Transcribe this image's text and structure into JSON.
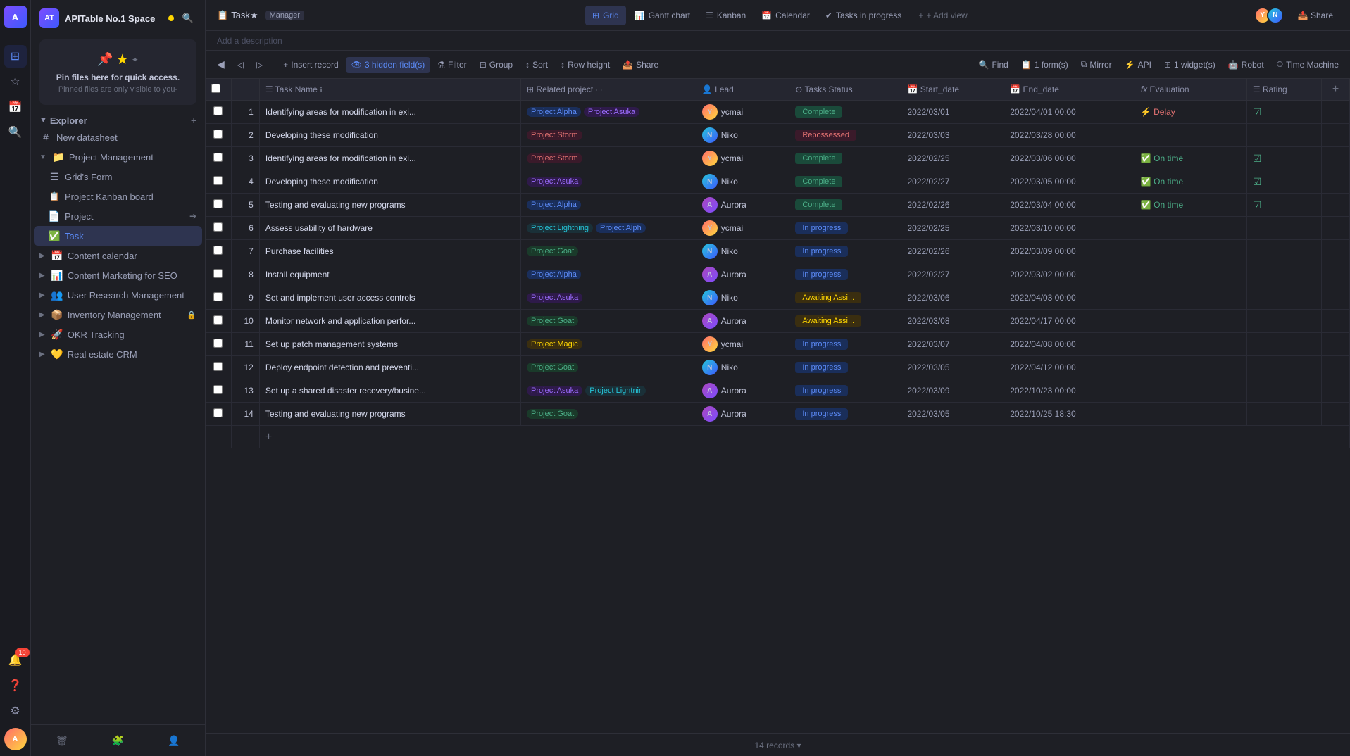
{
  "app": {
    "workspace": "APITable No.1 Space",
    "workspace_status": "online",
    "breadcrumb_task": "Task★",
    "manager_tag": "Manager",
    "add_description": "Add a description"
  },
  "left_icons": [
    "🏠",
    "★",
    "📅",
    "🔔",
    "❓",
    "⚙"
  ],
  "sidebar": {
    "pin_title": "Pin files here for quick access.",
    "pin_sub": "Pinned files are only visible to you-",
    "explorer_label": "Explorer",
    "items": [
      {
        "id": "new-datasheet",
        "label": "New datasheet",
        "icon": "#",
        "indent": 0
      },
      {
        "id": "project-management",
        "label": "Project Management",
        "icon": "📁",
        "indent": 0,
        "expanded": true
      },
      {
        "id": "grids-form",
        "label": "Grid's Form",
        "icon": "☰",
        "indent": 1
      },
      {
        "id": "project-kanban",
        "label": "Project Kanban board",
        "icon": "📋",
        "indent": 1
      },
      {
        "id": "project",
        "label": "Project",
        "icon": "📄",
        "indent": 1
      },
      {
        "id": "task",
        "label": "Task",
        "icon": "✅",
        "indent": 1,
        "active": true
      },
      {
        "id": "content-calendar",
        "label": "Content calendar",
        "icon": "📅",
        "indent": 0
      },
      {
        "id": "content-marketing",
        "label": "Content Marketing for SEO",
        "icon": "📊",
        "indent": 0
      },
      {
        "id": "user-research",
        "label": "User Research Management",
        "icon": "👥",
        "indent": 0
      },
      {
        "id": "inventory",
        "label": "Inventory Management",
        "icon": "📦",
        "indent": 0,
        "locked": true
      },
      {
        "id": "okr-tracking",
        "label": "OKR Tracking",
        "icon": "🚀",
        "indent": 0
      },
      {
        "id": "real-estate",
        "label": "Real estate CRM",
        "icon": "💛",
        "indent": 0
      }
    ]
  },
  "view_tabs": [
    {
      "id": "grid",
      "label": "Grid",
      "icon": "⊞",
      "active": true
    },
    {
      "id": "gantt",
      "label": "Gantt chart",
      "icon": "📊"
    },
    {
      "id": "kanban",
      "label": "Kanban",
      "icon": "☰"
    },
    {
      "id": "calendar",
      "label": "Calendar",
      "icon": "📅"
    },
    {
      "id": "tasks-progress",
      "label": "Tasks in progress",
      "icon": "✔"
    },
    {
      "id": "add-view",
      "label": "+ Add view",
      "icon": ""
    }
  ],
  "toolbar": {
    "insert_record": "Insert record",
    "hidden_fields": "3 hidden field(s)",
    "filter": "Filter",
    "group": "Group",
    "sort": "Sort",
    "row_height": "Row height",
    "share": "Share",
    "find": "Find",
    "forms": "1 form(s)",
    "mirror": "Mirror",
    "api": "API",
    "widget": "1 widget(s)",
    "robot": "Robot",
    "time_machine": "Time Machine"
  },
  "table": {
    "columns": [
      {
        "id": "checkbox",
        "label": "",
        "type": "checkbox"
      },
      {
        "id": "num",
        "label": "",
        "type": "num"
      },
      {
        "id": "task_name",
        "label": "Task Name",
        "icon": "☰"
      },
      {
        "id": "related_project",
        "label": "Related project",
        "icon": "⊞"
      },
      {
        "id": "lead",
        "label": "Lead",
        "icon": "👤"
      },
      {
        "id": "tasks_status",
        "label": "Tasks Status",
        "icon": "⊙"
      },
      {
        "id": "start_date",
        "label": "Start_date",
        "icon": "📅"
      },
      {
        "id": "end_date",
        "label": "End_date",
        "icon": "📅"
      },
      {
        "id": "evaluation",
        "label": "Evaluation",
        "icon": "fx"
      },
      {
        "id": "rating",
        "label": "Rating",
        "icon": "☰"
      }
    ],
    "rows": [
      {
        "num": 1,
        "task_name": "Identifying areas for modification in exi...",
        "projects": [
          "Project Alpha",
          "Project Asuka"
        ],
        "lead": "ycmai",
        "lead_type": "ycmai",
        "status": "Complete",
        "start_date": "2022/03/01",
        "end_date": "2022/04/01 00:00",
        "evaluation": "Delay",
        "rating": "✓"
      },
      {
        "num": 2,
        "task_name": "Developing these modification",
        "projects": [
          "Project Storm"
        ],
        "lead": "Niko",
        "lead_type": "niko",
        "status": "Repossessed",
        "start_date": "2022/03/03",
        "end_date": "2022/03/28 00:00",
        "evaluation": "",
        "rating": ""
      },
      {
        "num": 3,
        "task_name": "Identifying areas for modification in exi...",
        "projects": [
          "Project Storm"
        ],
        "lead": "ycmai",
        "lead_type": "ycmai",
        "status": "Complete",
        "start_date": "2022/02/25",
        "end_date": "2022/03/06 00:00",
        "evaluation": "On time",
        "rating": "✓"
      },
      {
        "num": 4,
        "task_name": "Developing these modification",
        "projects": [
          "Project Asuka"
        ],
        "lead": "Niko",
        "lead_type": "niko",
        "status": "Complete",
        "start_date": "2022/02/27",
        "end_date": "2022/03/05 00:00",
        "evaluation": "On time",
        "rating": "✓"
      },
      {
        "num": 5,
        "task_name": "Testing and evaluating new programs",
        "projects": [
          "Project Alpha"
        ],
        "lead": "Aurora",
        "lead_type": "aurora",
        "status": "Complete",
        "start_date": "2022/02/26",
        "end_date": "2022/03/04 00:00",
        "evaluation": "On time",
        "rating": "✓"
      },
      {
        "num": 6,
        "task_name": "Assess usability of hardware",
        "projects": [
          "Project Lightning",
          "Project Alph"
        ],
        "lead": "ycmai",
        "lead_type": "ycmai",
        "status": "In progress",
        "start_date": "2022/02/25",
        "end_date": "2022/03/10 00:00",
        "evaluation": "",
        "rating": ""
      },
      {
        "num": 7,
        "task_name": "Purchase facilities",
        "projects": [
          "Project Goat"
        ],
        "lead": "Niko",
        "lead_type": "niko",
        "status": "In progress",
        "start_date": "2022/02/26",
        "end_date": "2022/03/09 00:00",
        "evaluation": "",
        "rating": ""
      },
      {
        "num": 8,
        "task_name": "Install equipment",
        "projects": [
          "Project Alpha"
        ],
        "lead": "Aurora",
        "lead_type": "aurora",
        "status": "In progress",
        "start_date": "2022/02/27",
        "end_date": "2022/03/02 00:00",
        "evaluation": "",
        "rating": ""
      },
      {
        "num": 9,
        "task_name": "Set and implement user access controls",
        "projects": [
          "Project Asuka"
        ],
        "lead": "Niko",
        "lead_type": "niko",
        "status": "Awaiting Assi...",
        "start_date": "2022/03/06",
        "end_date": "2022/04/03 00:00",
        "evaluation": "",
        "rating": ""
      },
      {
        "num": 10,
        "task_name": "Monitor network and application perfor...",
        "projects": [
          "Project Goat"
        ],
        "lead": "Aurora",
        "lead_type": "aurora",
        "status": "Awaiting Assi...",
        "start_date": "2022/03/08",
        "end_date": "2022/04/17 00:00",
        "evaluation": "",
        "rating": ""
      },
      {
        "num": 11,
        "task_name": "Set up patch management systems",
        "projects": [
          "Project Magic"
        ],
        "lead": "ycmai",
        "lead_type": "ycmai",
        "status": "In progress",
        "start_date": "2022/03/07",
        "end_date": "2022/04/08 00:00",
        "evaluation": "",
        "rating": ""
      },
      {
        "num": 12,
        "task_name": "Deploy endpoint detection and preventi...",
        "projects": [
          "Project Goat"
        ],
        "lead": "Niko",
        "lead_type": "niko",
        "status": "In progress",
        "start_date": "2022/03/05",
        "end_date": "2022/04/12 00:00",
        "evaluation": "",
        "rating": ""
      },
      {
        "num": 13,
        "task_name": "Set up a shared disaster recovery/busine...",
        "projects": [
          "Project Asuka",
          "Project Lightnir"
        ],
        "lead": "Aurora",
        "lead_type": "aurora",
        "status": "In progress",
        "start_date": "2022/03/09",
        "end_date": "2022/10/23 00:00",
        "evaluation": "",
        "rating": ""
      },
      {
        "num": 14,
        "task_name": "Testing and evaluating new programs",
        "projects": [
          "Project Goat"
        ],
        "lead": "Aurora",
        "lead_type": "aurora",
        "status": "In progress",
        "start_date": "2022/03/05",
        "end_date": "2022/10/25 18:30",
        "evaluation": "",
        "rating": ""
      }
    ],
    "footer": "14 records ▾"
  }
}
